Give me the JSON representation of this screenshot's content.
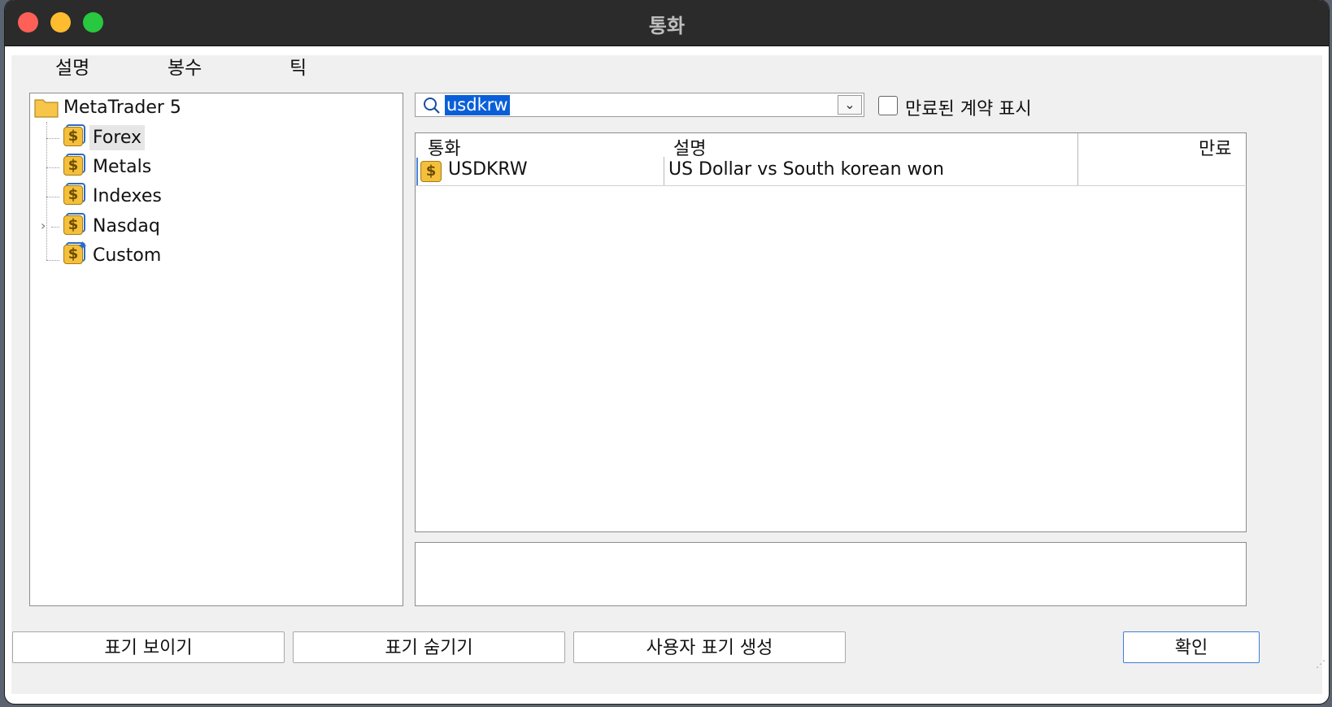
{
  "window": {
    "title": "통화"
  },
  "menu": [
    "설명",
    "봉수",
    "틱"
  ],
  "tree": {
    "root": "MetaTrader 5",
    "items": [
      {
        "label": "Forex",
        "selected": true,
        "expandable": false
      },
      {
        "label": "Metals",
        "selected": false,
        "expandable": false
      },
      {
        "label": "Indexes",
        "selected": false,
        "expandable": false
      },
      {
        "label": "Nasdaq",
        "selected": false,
        "expandable": true
      },
      {
        "label": "Custom",
        "selected": false,
        "expandable": false,
        "custom": true
      }
    ]
  },
  "search": {
    "value": "usdkrw"
  },
  "show_expired": {
    "label": "만료된 계약 표시",
    "checked": false
  },
  "table": {
    "columns": [
      "통화",
      "설명",
      "만료"
    ],
    "rows": [
      {
        "symbol": "USDKRW",
        "description": "US Dollar vs South korean won",
        "expiry": ""
      }
    ]
  },
  "buttons": {
    "show": "표기 보이기",
    "hide": "표기 숨기기",
    "create": "사용자 표기 생성",
    "ok": "확인"
  },
  "colors": {
    "selection": "#0a5fd8",
    "coin": "#f4c03c",
    "titlebar": "#2b2b2b"
  }
}
